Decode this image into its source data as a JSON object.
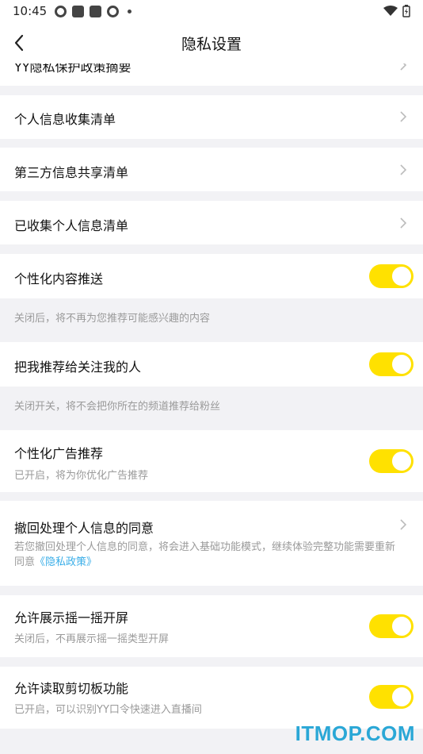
{
  "status_bar": {
    "time": "10:45"
  },
  "header": {
    "title": "隐私设置"
  },
  "rows": {
    "summary": {
      "label": "YY隐私保护政策摘要"
    },
    "personal_collect": {
      "label": "个人信息收集清单"
    },
    "third_party": {
      "label": "第三方信息共享清单"
    },
    "collected": {
      "label": "已收集个人信息清单"
    },
    "personalized_content": {
      "label": "个性化内容推送",
      "note": "关闭后，将不再为您推荐可能感兴趣的内容",
      "enabled": true
    },
    "recommend_me": {
      "label": "把我推荐给关注我的人",
      "note": "关闭开关，将不会把你所在的频道推荐给粉丝",
      "enabled": true
    },
    "personalized_ads": {
      "label": "个性化广告推荐",
      "sub": "已开启，将为你优化广告推荐",
      "enabled": true
    },
    "revoke": {
      "label": "撤回处理个人信息的同意",
      "sub_line1": "若您撤回处理个人信息的同意，将会进入基础功能模式，继续体验完整功能需要重新",
      "sub_prefix": "同意",
      "link": "《隐私政策》"
    },
    "shake": {
      "label": "允许展示摇一摇开屏",
      "sub": "关闭后，不再展示摇一摇类型开屏",
      "enabled": true
    },
    "clipboard": {
      "label": "允许读取剪切板功能",
      "sub": "已开启，可以识别YY口令快速进入直播间",
      "enabled": true
    }
  },
  "watermark": "ITMOP.COM",
  "colors": {
    "toggle_on": "#ffe100",
    "link": "#3aaee8",
    "background": "#f2f2f5"
  }
}
